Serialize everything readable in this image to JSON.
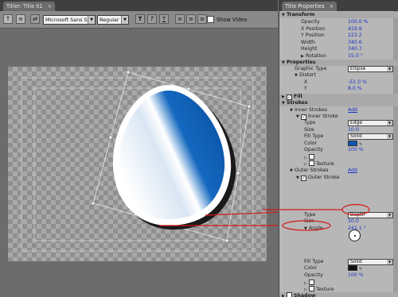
{
  "left_panel": {
    "tab_label": "Titler: Title 01",
    "toolbar": {
      "font_name": "Microsoft Sans Serif",
      "font_style": "Regular",
      "show_video_label": "Show Video"
    }
  },
  "right_panel": {
    "tab_label": "Title Properties",
    "rows": [
      {
        "type": "section",
        "label": "Transform"
      },
      {
        "label": "Opacity",
        "value": "100.0 %"
      },
      {
        "label": "X Position",
        "value": "419.9"
      },
      {
        "label": "Y Position",
        "value": "223.2"
      },
      {
        "label": "Width",
        "value": "340.6"
      },
      {
        "label": "Height",
        "value": "340.7"
      },
      {
        "label": "Rotation",
        "value": "15.0 °"
      },
      {
        "type": "section",
        "label": "Properties"
      },
      {
        "label": "Graphic Type",
        "dropdown": "Ellipse"
      },
      {
        "label": "Distort"
      },
      {
        "label": "X",
        "value": "-51.0 %"
      },
      {
        "label": "Y",
        "value": "8.0 %"
      },
      {
        "type": "section",
        "label": "Fill"
      },
      {
        "type": "section",
        "label": "Strokes"
      },
      {
        "label": "Inner Strokes",
        "link": "Add"
      },
      {
        "label": "Inner Stroke"
      },
      {
        "label": "Type",
        "dropdown": "Edge"
      },
      {
        "label": "Size",
        "value": "10.0"
      },
      {
        "label": "Fill Type",
        "dropdown": "Solid"
      },
      {
        "label": "Color"
      },
      {
        "label": "Opacity",
        "value": "100 %"
      },
      {
        "label": ""
      },
      {
        "label": "Texture"
      },
      {
        "label": "Outer Strokes",
        "link": "Add"
      },
      {
        "label": "Outer Stroke"
      },
      {
        "label": "Type",
        "dropdown": "Depth"
      },
      {
        "label": "Size",
        "value": "50.0"
      },
      {
        "label": "Angle",
        "value": "241.1 °"
      },
      {
        "label": "Fill Type",
        "dropdown": "Solid"
      },
      {
        "label": "Color"
      },
      {
        "label": "Opacity",
        "value": "100 %"
      },
      {
        "label": ""
      },
      {
        "label": "Texture"
      },
      {
        "type": "section",
        "label": "Shadow"
      }
    ]
  },
  "colors": {
    "accent_blue": "#1c35c7",
    "callout_red": "#d21a1a",
    "panel_bg": "#b7b7b7"
  }
}
